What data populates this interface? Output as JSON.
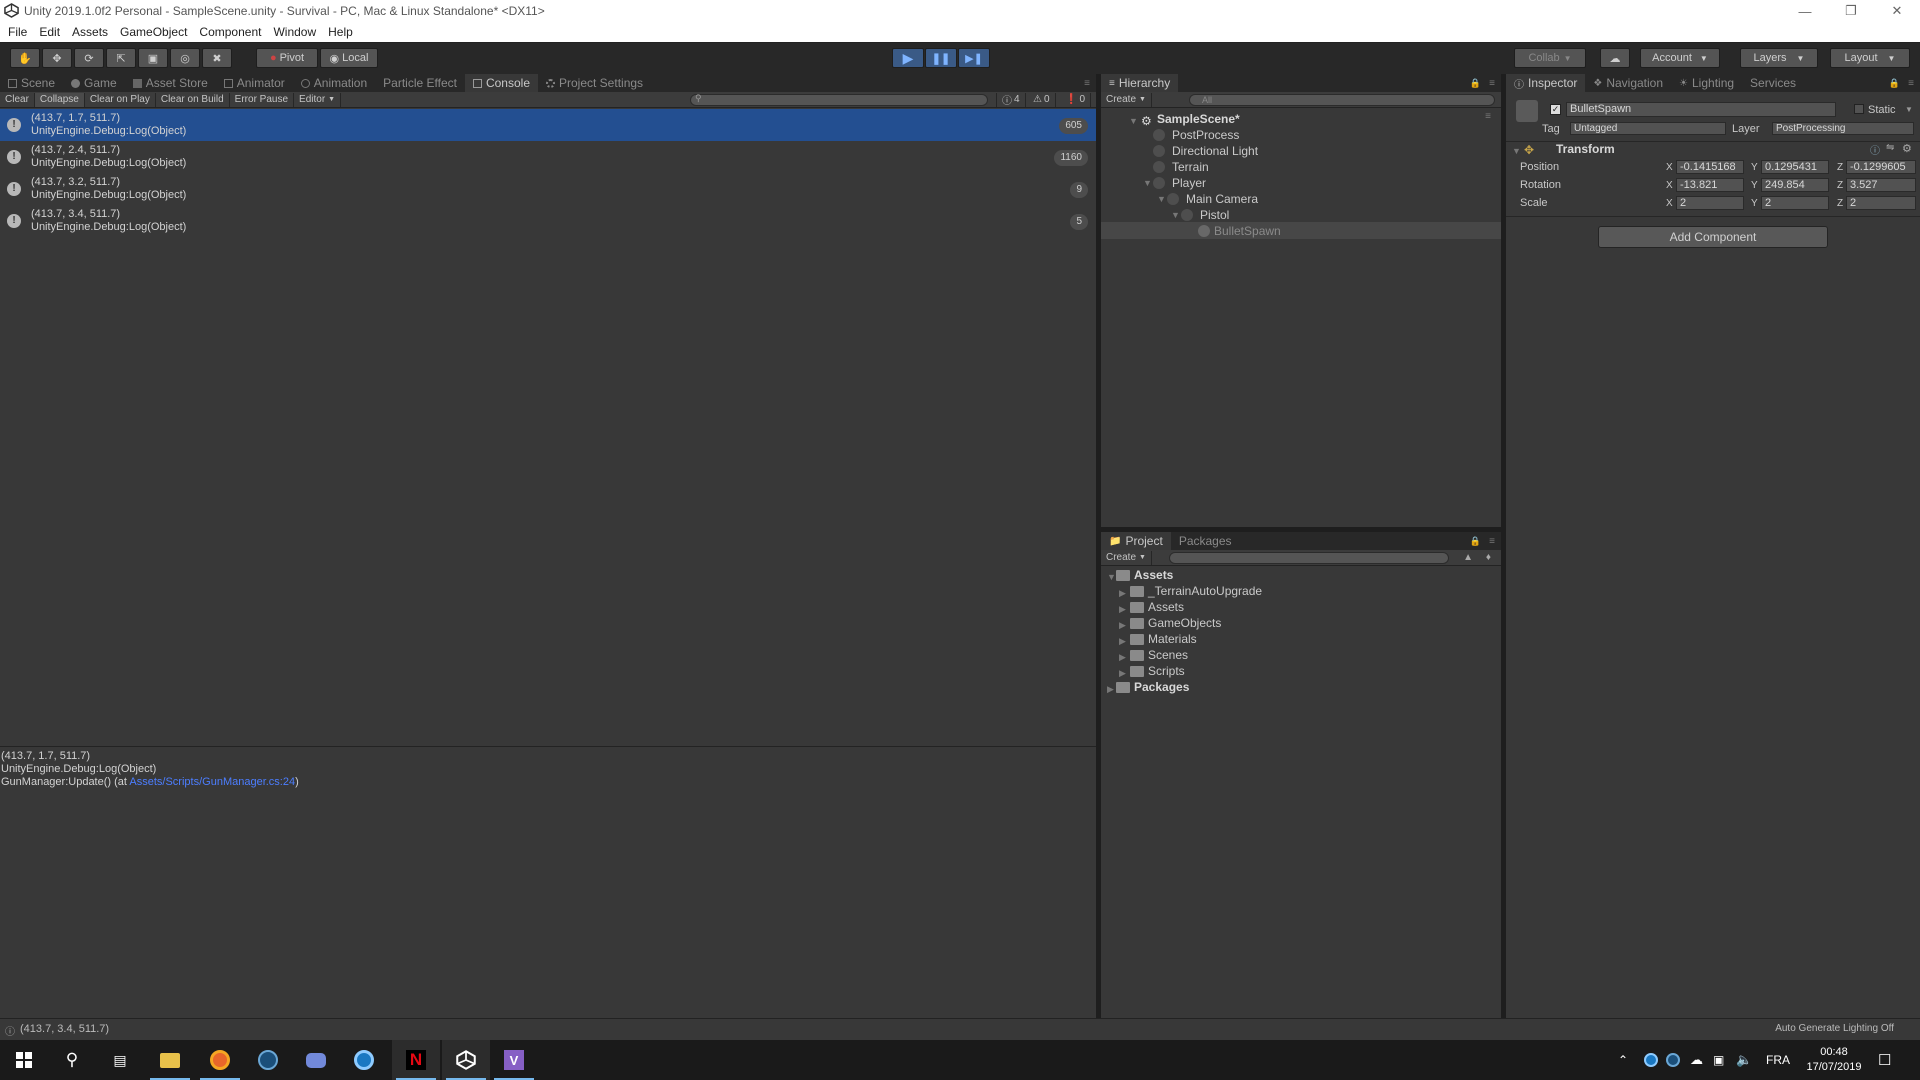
{
  "window": {
    "title": "Unity 2019.1.0f2 Personal - SampleScene.unity - Survival - PC, Mac & Linux Standalone* <DX11>"
  },
  "menu": [
    "File",
    "Edit",
    "Assets",
    "GameObject",
    "Component",
    "Window",
    "Help"
  ],
  "toolbar": {
    "pivot": "Pivot",
    "local": "Local",
    "collab": "Collab",
    "account": "Account",
    "layers": "Layers",
    "layout": "Layout",
    "play_color": "#4a7ec7"
  },
  "main_tabs": [
    "Scene",
    "Game",
    "Asset Store",
    "Animator",
    "Animation",
    "Particle Effect",
    "Console",
    "Project Settings"
  ],
  "console": {
    "buttons": [
      "Clear",
      "Collapse",
      "Clear on Play",
      "Clear on Build",
      "Error Pause",
      "Editor"
    ],
    "counts": {
      "logs": "4",
      "warnings": "0",
      "errors": "0"
    },
    "entries": [
      {
        "line1": "(413.7, 1.7, 511.7)",
        "line2": "UnityEngine.Debug:Log(Object)",
        "count": "605"
      },
      {
        "line1": "(413.7, 2.4, 511.7)",
        "line2": "UnityEngine.Debug:Log(Object)",
        "count": "1160"
      },
      {
        "line1": "(413.7, 3.2, 511.7)",
        "line2": "UnityEngine.Debug:Log(Object)",
        "count": "9"
      },
      {
        "line1": "(413.7, 3.4, 511.7)",
        "line2": "UnityEngine.Debug:Log(Object)",
        "count": "5"
      }
    ],
    "detail": {
      "line1": "(413.7, 1.7, 511.7)",
      "line2": "UnityEngine.Debug:Log(Object)",
      "line3_prefix": "GunManager:Update() (at ",
      "link": "Assets/Scripts/GunManager.cs:24",
      "line3_suffix": ")"
    },
    "selected_color": "#234f91"
  },
  "hierarchy": {
    "tab": "Hierarchy",
    "create": "Create",
    "search_placeholder": "All",
    "scene": "SampleScene*",
    "items": [
      "PostProcess",
      "Directional Light",
      "Terrain",
      "Player",
      "Main Camera",
      "Pistol",
      "BulletSpawn"
    ]
  },
  "project": {
    "tabs": [
      "Project",
      "Packages"
    ],
    "create": "Create",
    "root": "Assets",
    "folders": [
      "_TerrainAutoUpgrade",
      "Assets",
      "GameObjects",
      "Materials",
      "Scenes",
      "Scripts"
    ],
    "packages": "Packages"
  },
  "inspector": {
    "tabs": [
      "Inspector",
      "Navigation",
      "Lighting",
      "Services"
    ],
    "object_name": "BulletSpawn",
    "static_label": "Static",
    "tag_label": "Tag",
    "tag_value": "Untagged",
    "layer_label": "Layer",
    "layer_value": "PostProcessing",
    "component": "Transform",
    "position_label": "Position",
    "rotation_label": "Rotation",
    "scale_label": "Scale",
    "position": {
      "x": "-0.1415168",
      "y": "0.1295431",
      "z": "-0.1299605"
    },
    "rotation": {
      "x": "-13.821",
      "y": "249.854",
      "z": "3.527"
    },
    "scale": {
      "x": "2",
      "y": "2",
      "z": "2"
    },
    "add_component": "Add Component"
  },
  "statusbar": {
    "message": "(413.7, 3.4, 511.7)",
    "right": "Auto Generate Lighting Off"
  },
  "taskbar": {
    "lang": "FRA",
    "time": "00:48",
    "date": "17/07/2019"
  }
}
